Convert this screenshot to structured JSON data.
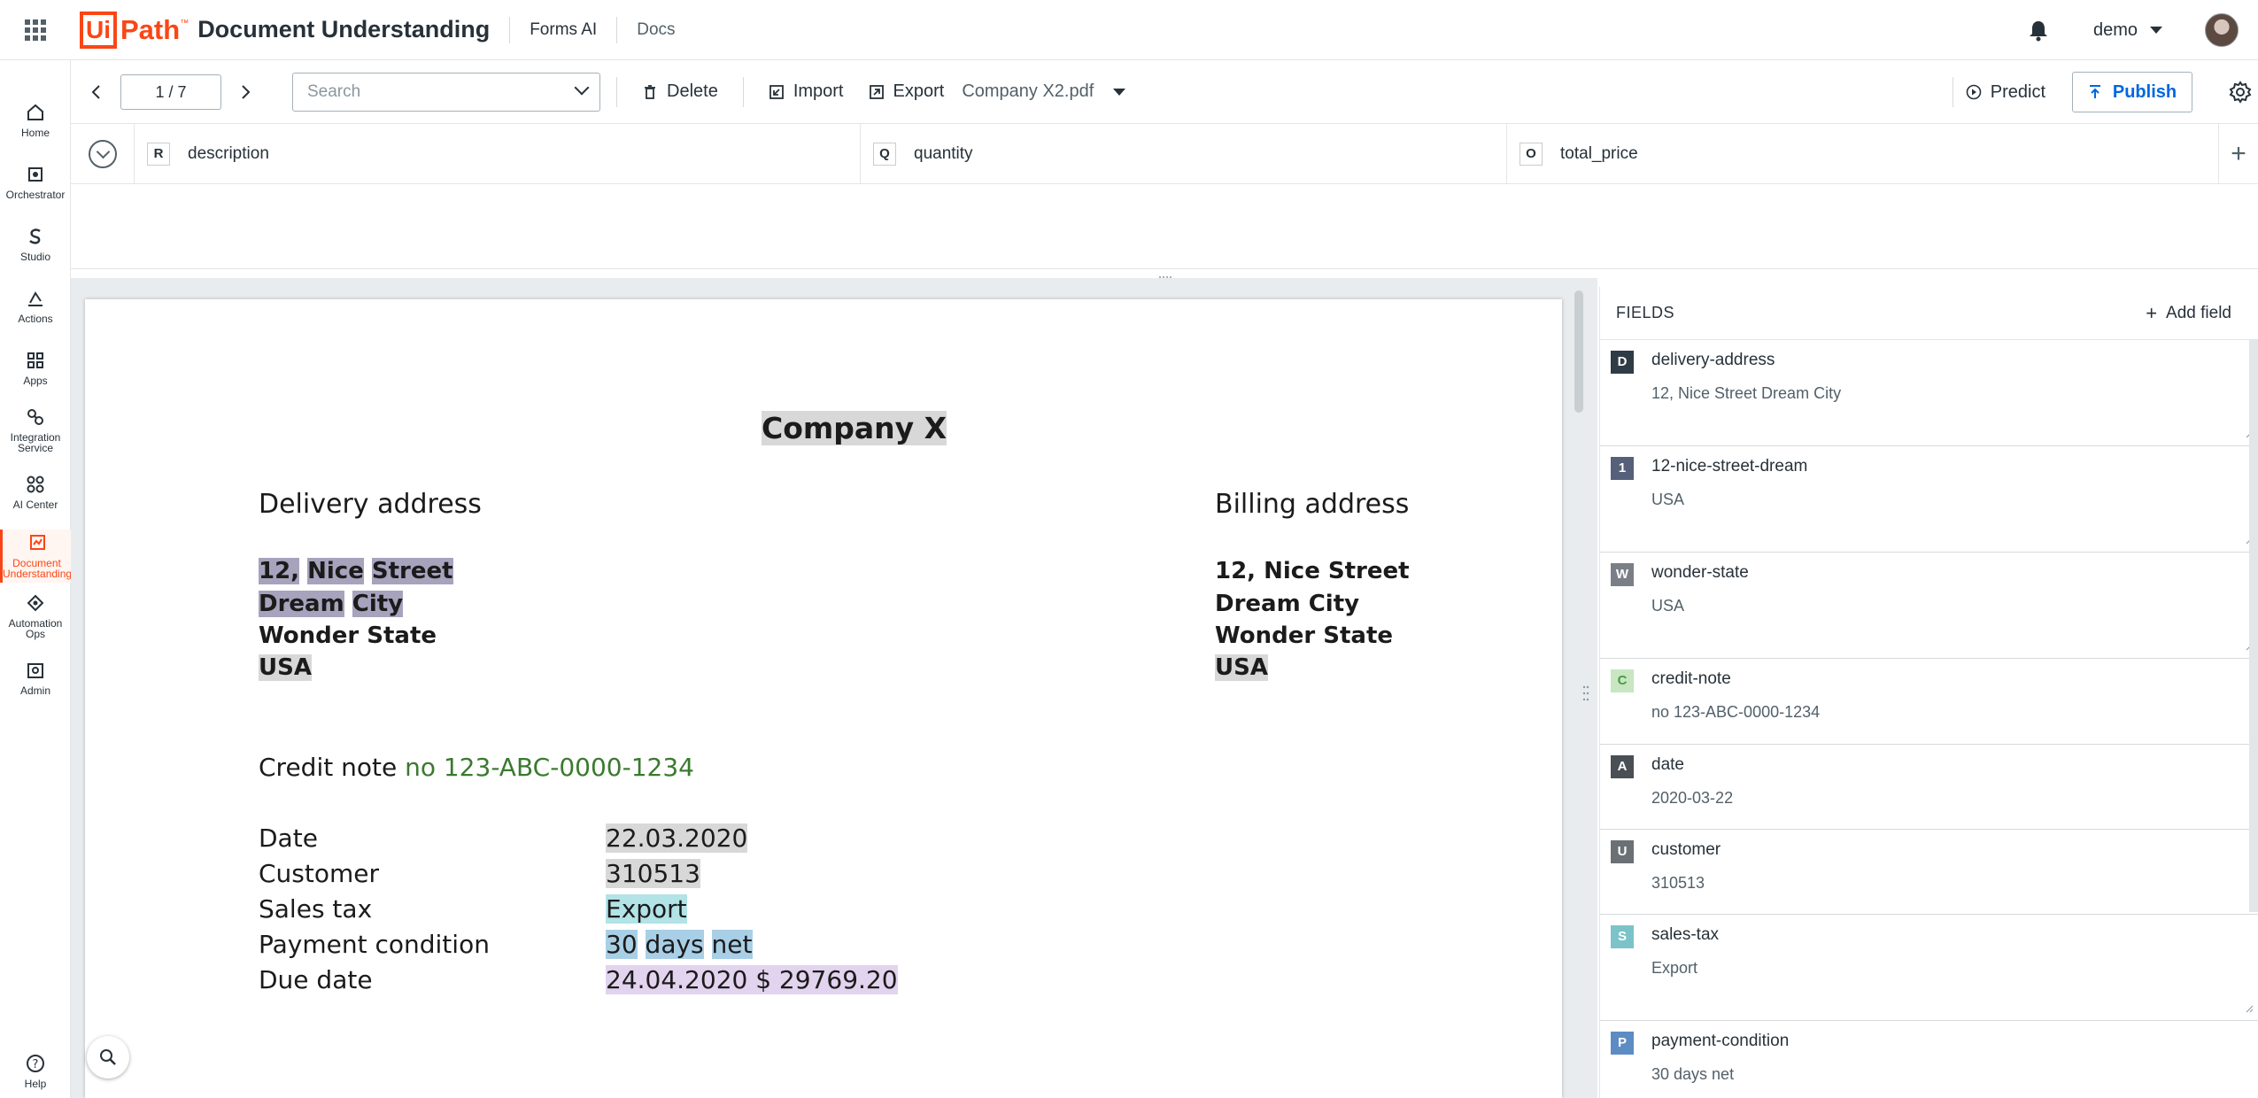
{
  "topbar": {
    "logo_ui": "Ui",
    "logo_path": "Path",
    "logo_tm": "™",
    "product": "Document Understanding",
    "link_forms": "Forms AI",
    "link_docs": "Docs",
    "user": "demo"
  },
  "nav": [
    {
      "label": "Home",
      "icon": "home-icon"
    },
    {
      "label": "Orchestrator",
      "icon": "orchestrator-icon"
    },
    {
      "label": "Studio",
      "icon": "studio-icon"
    },
    {
      "label": "Actions",
      "icon": "actions-icon"
    },
    {
      "label": "Apps",
      "icon": "apps-icon"
    },
    {
      "label1": "Integration",
      "label2": "Service",
      "icon": "integration-service-icon"
    },
    {
      "label": "AI Center",
      "icon": "ai-center-icon"
    },
    {
      "label1": "Document",
      "label2": "Understanding",
      "icon": "document-understanding-icon"
    },
    {
      "label1": "Automation",
      "label2": "Ops",
      "icon": "automation-ops-icon"
    },
    {
      "label": "Admin",
      "icon": "admin-icon"
    },
    {
      "label": "Help",
      "icon": "help-icon"
    }
  ],
  "toolbar": {
    "pager": "1 / 7",
    "search_placeholder": "Search",
    "delete": "Delete",
    "import": "Import",
    "export": "Export",
    "file": "Company X2.pdf",
    "predict": "Predict",
    "publish": "Publish"
  },
  "columns": [
    {
      "key": "R",
      "name": "description"
    },
    {
      "key": "Q",
      "name": "quantity"
    },
    {
      "key": "O",
      "name": "total_price"
    }
  ],
  "document": {
    "title": "Company X",
    "delivery_heading": "Delivery address",
    "billing_heading": "Billing address",
    "delivery": {
      "line1_a": "12,",
      "line1_b": "Nice",
      "line1_c": "Street",
      "line2_a": "Dream",
      "line2_b": "City",
      "line3": "Wonder State",
      "line4": "USA"
    },
    "billing": {
      "line1": "12, Nice Street",
      "line2": "Dream City",
      "line3": "Wonder State",
      "line4": "USA"
    },
    "credit_label": "Credit note",
    "credit_value": "no 123-ABC-0000-1234",
    "rows": {
      "date_label": "Date",
      "date_value": "22.03.2020",
      "customer_label": "Customer",
      "customer_value": "310513",
      "sales_label": "Sales tax",
      "sales_value": "Export",
      "payment_label": "Payment condition",
      "payment_v1": "30",
      "payment_v2": "days",
      "payment_v3": "net",
      "due_label": "Due date",
      "due_value": "24.04.2020 $ 29769.20"
    }
  },
  "fields_panel": {
    "title": "FIELDS",
    "add": "Add field",
    "items": [
      {
        "key": "D",
        "color": "#2f3b45",
        "name": "delivery-address",
        "value": "12, Nice Street Dream City"
      },
      {
        "key": "1",
        "color": "#56607a",
        "name": "12-nice-street-dream",
        "value": "USA"
      },
      {
        "key": "W",
        "color": "#7a7f87",
        "name": "wonder-state",
        "value": "USA"
      },
      {
        "key": "C",
        "color": "#c7e6c1",
        "name": "credit-note",
        "value": "no 123-ABC-0000-1234"
      },
      {
        "key": "A",
        "color": "#4a4f55",
        "name": "date",
        "value": "2020-03-22"
      },
      {
        "key": "U",
        "color": "#6b7075",
        "name": "customer",
        "value": "310513"
      },
      {
        "key": "S",
        "color": "#7bc3c9",
        "name": "sales-tax",
        "value": "Export"
      },
      {
        "key": "P",
        "color": "#5d8cc4",
        "name": "payment-condition",
        "value": "30 days net"
      }
    ]
  }
}
